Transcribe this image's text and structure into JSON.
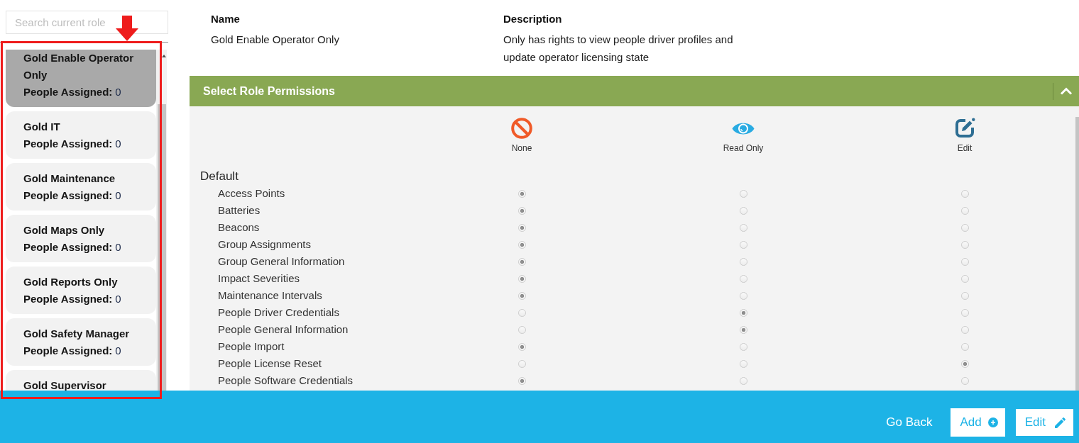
{
  "sidebar": {
    "search": {
      "placeholder": "Search current role"
    },
    "roles": [
      {
        "name": "Gold Enable Operator Only",
        "assigned_label": "People Assigned:",
        "assigned": "0",
        "selected": true
      },
      {
        "name": "Gold IT",
        "assigned_label": "People Assigned:",
        "assigned": "0",
        "selected": false
      },
      {
        "name": "Gold Maintenance",
        "assigned_label": "People Assigned:",
        "assigned": "0",
        "selected": false
      },
      {
        "name": "Gold Maps Only",
        "assigned_label": "People Assigned:",
        "assigned": "0",
        "selected": false
      },
      {
        "name": "Gold Reports Only",
        "assigned_label": "People Assigned:",
        "assigned": "0",
        "selected": false
      },
      {
        "name": "Gold Safety Manager",
        "assigned_label": "People Assigned:",
        "assigned": "0",
        "selected": false
      },
      {
        "name": "Gold Supervisor",
        "selected": false
      }
    ]
  },
  "details": {
    "name_label": "Name",
    "name": "Gold Enable Operator Only",
    "description_label": "Description",
    "description": "Only has rights to view people driver profiles and update operator licensing state"
  },
  "permissions": {
    "title": "Select Role Permissions",
    "expanded": true,
    "columns": [
      {
        "label": "None",
        "kind": "none"
      },
      {
        "label": "Read Only",
        "kind": "read"
      },
      {
        "label": "Edit",
        "kind": "edit"
      }
    ],
    "group": "Default",
    "rows": [
      {
        "label": "Access Points",
        "choices": [
          {
            "selected": true
          },
          {
            "selected": false
          },
          {
            "selected": false
          }
        ]
      },
      {
        "label": "Batteries",
        "choices": [
          {
            "selected": true
          },
          {
            "selected": false
          },
          {
            "selected": false
          }
        ]
      },
      {
        "label": "Beacons",
        "choices": [
          {
            "selected": true
          },
          {
            "selected": false
          },
          {
            "selected": false
          }
        ]
      },
      {
        "label": "Group Assignments",
        "choices": [
          {
            "selected": true
          },
          {
            "selected": false
          },
          {
            "selected": false
          }
        ]
      },
      {
        "label": "Group General Information",
        "choices": [
          {
            "selected": true
          },
          {
            "selected": false
          },
          {
            "selected": false
          }
        ]
      },
      {
        "label": "Impact Severities",
        "choices": [
          {
            "selected": true
          },
          {
            "selected": false
          },
          {
            "selected": false
          }
        ]
      },
      {
        "label": "Maintenance Intervals",
        "choices": [
          {
            "selected": true
          },
          {
            "selected": false
          },
          {
            "selected": false
          }
        ]
      },
      {
        "label": "People Driver Credentials",
        "choices": [
          {
            "selected": false
          },
          {
            "selected": true
          },
          {
            "selected": false
          }
        ]
      },
      {
        "label": "People General Information",
        "choices": [
          {
            "selected": false
          },
          {
            "selected": true
          },
          {
            "selected": false
          }
        ]
      },
      {
        "label": "People Import",
        "choices": [
          {
            "selected": true
          },
          {
            "selected": false
          },
          {
            "selected": false
          }
        ]
      },
      {
        "label": "People License Reset",
        "choices": [
          {
            "selected": false
          },
          {
            "selected": false
          },
          {
            "selected": true
          }
        ]
      },
      {
        "label": "People Software Credentials",
        "choices": [
          {
            "selected": true
          },
          {
            "selected": false
          },
          {
            "selected": false
          }
        ]
      }
    ]
  },
  "footer": {
    "buttons": [
      {
        "label": "Go Back",
        "kind": "link"
      },
      {
        "label": "Add",
        "kind": "add"
      },
      {
        "label": "Edit",
        "kind": "edit"
      }
    ]
  },
  "annotation": {
    "frame": true,
    "arrow": true
  }
}
